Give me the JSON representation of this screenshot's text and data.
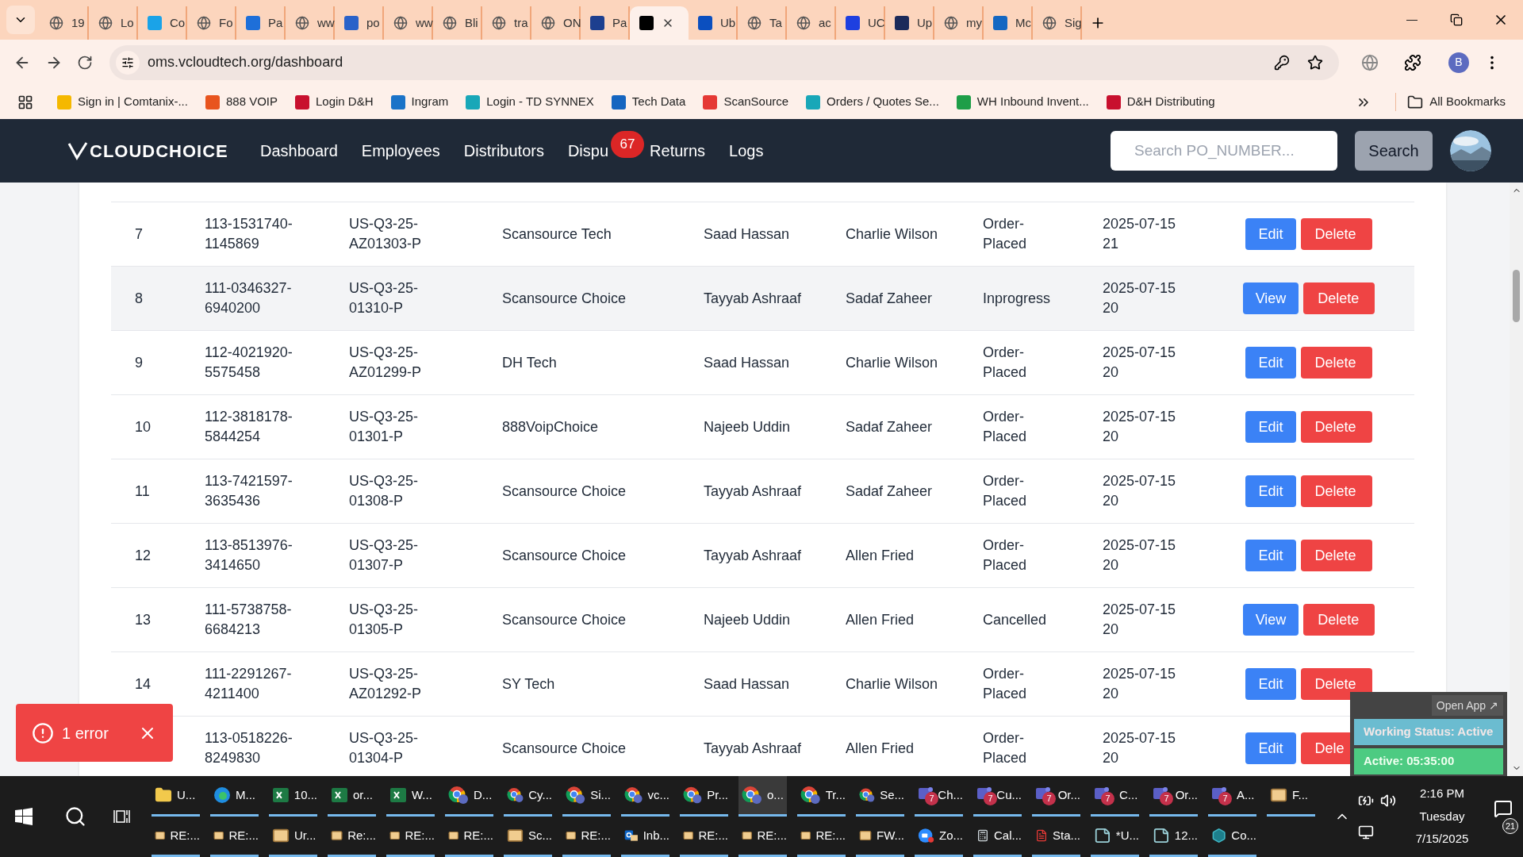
{
  "browser": {
    "tabs": [
      {
        "label": "19",
        "kind": "globe",
        "selected": false
      },
      {
        "label": "Lo",
        "kind": "globe",
        "selected": false
      },
      {
        "label": "Co",
        "kind": "logo",
        "color": "#1aa3e8",
        "selected": false
      },
      {
        "label": "Fo",
        "kind": "globe",
        "selected": false
      },
      {
        "label": "Pa",
        "kind": "logo",
        "color": "#1e6fd9",
        "selected": false
      },
      {
        "label": "ww",
        "kind": "globe",
        "selected": false
      },
      {
        "label": "po",
        "kind": "logo",
        "color": "#2a62c9",
        "selected": false
      },
      {
        "label": "ww",
        "kind": "globe",
        "selected": false
      },
      {
        "label": "Bli",
        "kind": "globe",
        "selected": false
      },
      {
        "label": "tra",
        "kind": "globe",
        "selected": false
      },
      {
        "label": "ON",
        "kind": "globe",
        "selected": false
      },
      {
        "label": "Pa",
        "kind": "logo",
        "color": "#1d3f8f",
        "selected": false
      },
      {
        "kind": "logo",
        "color": "#000000",
        "selected": true
      },
      {
        "label": "Ub",
        "kind": "logo",
        "color": "#0b4fbf",
        "selected": false
      },
      {
        "label": "Ta",
        "kind": "globe",
        "selected": false
      },
      {
        "label": "ac",
        "kind": "globe",
        "selected": false
      },
      {
        "label": "UC",
        "kind": "logo",
        "color": "#1e3fe0",
        "selected": false
      },
      {
        "label": "Up",
        "kind": "logo",
        "color": "#1b2a5a",
        "selected": false
      },
      {
        "label": "my",
        "kind": "globe",
        "selected": false
      },
      {
        "label": "Mc",
        "kind": "logo",
        "color": "#1467c2",
        "selected": false
      },
      {
        "label": "Sig",
        "kind": "globe",
        "selected": false
      }
    ],
    "address": "oms.vcloudtech.org/dashboard",
    "profile_initial": "B",
    "bookmarks": [
      {
        "label": "Sign in | Comtanix-...",
        "color": "#f5b800"
      },
      {
        "label": "888 VOIP",
        "color": "#e8541e"
      },
      {
        "label": "Login D&H",
        "color": "#c8102e"
      },
      {
        "label": "Ingram",
        "color": "#1a73c8"
      },
      {
        "label": "Login - TD SYNNEX",
        "color": "#19a7b8"
      },
      {
        "label": "Tech Data",
        "color": "#1565c0"
      },
      {
        "label": "ScanSource",
        "color": "#e53935"
      },
      {
        "label": "Orders / Quotes Se...",
        "color": "#19a7b8"
      },
      {
        "label": "WH Inbound Invent...",
        "color": "#1e9e48"
      },
      {
        "label": "D&H Distributing",
        "color": "#c8102e"
      }
    ],
    "all_bookmarks": "All Bookmarks"
  },
  "app": {
    "logo": "CLOUDCHOICE",
    "nav": [
      {
        "label": "Dashboard"
      },
      {
        "label": "Employees"
      },
      {
        "label": "Distributors"
      },
      {
        "label": "Dispu",
        "badge": "67"
      },
      {
        "label": "Returns"
      },
      {
        "label": "Logs"
      }
    ],
    "search": {
      "placeholder": "Search PO_NUMBER...",
      "button": "Search"
    }
  },
  "table": {
    "rows": [
      {
        "number": "7",
        "order": "113-1531740-1145869",
        "reference": "US-Q3-25-AZ01303-P",
        "distributor": "Scansource Tech",
        "employee": "Saad Hassan",
        "manager": "Charlie Wilson",
        "status": "Order-Placed",
        "date": "2025-07-15 21",
        "highlighted": false,
        "actions": [
          {
            "label": "Edit",
            "kind": "primary"
          },
          {
            "label": "Delete",
            "kind": "danger"
          }
        ]
      },
      {
        "number": "8",
        "order": "111-0346327-6940200",
        "reference": "US-Q3-25-01310-P",
        "distributor": "Scansource Choice",
        "employee": "Tayyab Ashraaf",
        "manager": "Sadaf Zaheer",
        "status": "Inprogress",
        "date": "2025-07-15 20",
        "highlighted": true,
        "actions": [
          {
            "label": "View",
            "kind": "primary"
          },
          {
            "label": "Delete",
            "kind": "danger"
          }
        ]
      },
      {
        "number": "9",
        "order": "112-4021920-5575458",
        "reference": "US-Q3-25-AZ01299-P",
        "distributor": "DH Tech",
        "employee": "Saad Hassan",
        "manager": "Charlie Wilson",
        "status": "Order-Placed",
        "date": "2025-07-15 20",
        "highlighted": false,
        "actions": [
          {
            "label": "Edit",
            "kind": "primary"
          },
          {
            "label": "Delete",
            "kind": "danger"
          }
        ]
      },
      {
        "number": "10",
        "order": "112-3818178-5844254",
        "reference": "US-Q3-25-01301-P",
        "distributor": "888VoipChoice",
        "employee": "Najeeb Uddin",
        "manager": "Sadaf Zaheer",
        "status": "Order-Placed",
        "date": "2025-07-15 20",
        "highlighted": false,
        "actions": [
          {
            "label": "Edit",
            "kind": "primary"
          },
          {
            "label": "Delete",
            "kind": "danger"
          }
        ]
      },
      {
        "number": "11",
        "order": "113-7421597-3635436",
        "reference": "US-Q3-25-01308-P",
        "distributor": "Scansource Choice",
        "employee": "Tayyab Ashraaf",
        "manager": "Sadaf Zaheer",
        "status": "Order-Placed",
        "date": "2025-07-15 20",
        "highlighted": false,
        "actions": [
          {
            "label": "Edit",
            "kind": "primary"
          },
          {
            "label": "Delete",
            "kind": "danger"
          }
        ]
      },
      {
        "number": "12",
        "order": "113-8513976-3414650",
        "reference": "US-Q3-25-01307-P",
        "distributor": "Scansource Choice",
        "employee": "Tayyab Ashraaf",
        "manager": "Allen Fried",
        "status": "Order-Placed",
        "date": "2025-07-15 20",
        "highlighted": false,
        "actions": [
          {
            "label": "Edit",
            "kind": "primary"
          },
          {
            "label": "Delete",
            "kind": "danger"
          }
        ]
      },
      {
        "number": "13",
        "order": "111-5738758-6684213",
        "reference": "US-Q3-25-01305-P",
        "distributor": "Scansource Choice",
        "employee": "Najeeb Uddin",
        "manager": "Allen Fried",
        "status": "Cancelled",
        "date": "2025-07-15 20",
        "highlighted": false,
        "actions": [
          {
            "label": "View",
            "kind": "primary"
          },
          {
            "label": "Delete",
            "kind": "danger"
          }
        ]
      },
      {
        "number": "14",
        "order": "111-2291267-4211400",
        "reference": "US-Q3-25-AZ01292-P",
        "distributor": "SY Tech",
        "employee": "Saad Hassan",
        "manager": "Charlie Wilson",
        "status": "Order-Placed",
        "date": "2025-07-15 20",
        "highlighted": false,
        "actions": [
          {
            "label": "Edit",
            "kind": "primary"
          },
          {
            "label": "Delete",
            "kind": "danger"
          }
        ]
      },
      {
        "order": "113-0518226-8249830",
        "reference": "US-Q3-25-01304-P",
        "distributor": "Scansource Choice",
        "employee": "Tayyab Ashraaf",
        "manager": "Allen Fried",
        "status": "Order-Placed",
        "date": "2025-07-15 20",
        "highlighted": false,
        "actions": [
          {
            "label": "Edit",
            "kind": "primary"
          },
          {
            "label": "Dele",
            "kind": "danger"
          }
        ]
      }
    ]
  },
  "error_toast": {
    "text": "1 error"
  },
  "tracker": {
    "open_app": "Open App ↗",
    "status": "Working Status: Active",
    "timer": "Active: 05:35:00"
  },
  "taskbar": {
    "row_1": [
      {
        "label": "U...",
        "kind": "folder",
        "selected": false
      },
      {
        "label": "M...",
        "kind": "edge",
        "selected": false
      },
      {
        "label": "10...",
        "kind": "excel",
        "selected": false
      },
      {
        "label": "or...",
        "kind": "excel",
        "selected": false
      },
      {
        "label": "W...",
        "kind": "excel",
        "selected": false
      },
      {
        "label": "D...",
        "kind": "chrome",
        "selected": false
      },
      {
        "label": "Cy...",
        "kind": "chrome",
        "selected": false
      },
      {
        "label": "Si...",
        "kind": "chrome",
        "selected": false
      },
      {
        "label": "vc...",
        "kind": "chrome",
        "selected": false
      },
      {
        "label": "Pr...",
        "kind": "chrome",
        "selected": false
      },
      {
        "label": "o...",
        "kind": "chrome",
        "selected": true
      },
      {
        "label": "Tr...",
        "kind": "chrome",
        "selected": false
      },
      {
        "label": "Se...",
        "kind": "chrome",
        "selected": false
      },
      {
        "label": "Ch...",
        "kind": "teams",
        "badge": "7",
        "selected": false
      },
      {
        "label": "Cu...",
        "kind": "teams",
        "badge": "7",
        "selected": false
      },
      {
        "label": "Or...",
        "kind": "teams",
        "badge": "7",
        "selected": false
      },
      {
        "label": "C...",
        "kind": "teams",
        "badge": "7",
        "selected": false
      },
      {
        "label": "Or...",
        "kind": "teams",
        "badge": "7",
        "selected": false
      },
      {
        "label": "A...",
        "kind": "teams",
        "badge": "7",
        "selected": false
      },
      {
        "label": "F...",
        "kind": "mail",
        "selected": false
      }
    ],
    "row_2": [
      {
        "label": "RE:...",
        "kind": "mail",
        "selected": false
      },
      {
        "label": "RE:...",
        "kind": "mail",
        "selected": false
      },
      {
        "label": "Ur...",
        "kind": "mail",
        "selected": false
      },
      {
        "label": "Re:...",
        "kind": "mail",
        "selected": false
      },
      {
        "label": "RE:...",
        "kind": "mail",
        "selected": false
      },
      {
        "label": "RE:...",
        "kind": "mail",
        "selected": false
      },
      {
        "label": "Sc...",
        "kind": "mail",
        "selected": false
      },
      {
        "label": "RE:...",
        "kind": "mail",
        "selected": false
      },
      {
        "label": "Inb...",
        "kind": "outlook",
        "selected": false
      },
      {
        "label": "RE:...",
        "kind": "mail",
        "selected": false
      },
      {
        "label": "RE:...",
        "kind": "mail",
        "selected": false
      },
      {
        "label": "RE:...",
        "kind": "mail",
        "selected": false
      },
      {
        "label": "FW...",
        "kind": "mail",
        "selected": false
      },
      {
        "label": "Zo...",
        "kind": "zoom",
        "selected": false
      },
      {
        "label": "Cal...",
        "kind": "calculator",
        "selected": false
      },
      {
        "label": "Sta...",
        "kind": "pdf",
        "selected": false
      },
      {
        "label": "*U...",
        "kind": "notepad",
        "selected": false
      },
      {
        "label": "12...",
        "kind": "notepad",
        "selected": false
      },
      {
        "label": "Co...",
        "kind": "app",
        "selected": false
      }
    ],
    "clock": {
      "time": "2:16 PM",
      "day": "Tuesday",
      "date": "7/15/2025"
    },
    "notifications": "21"
  }
}
